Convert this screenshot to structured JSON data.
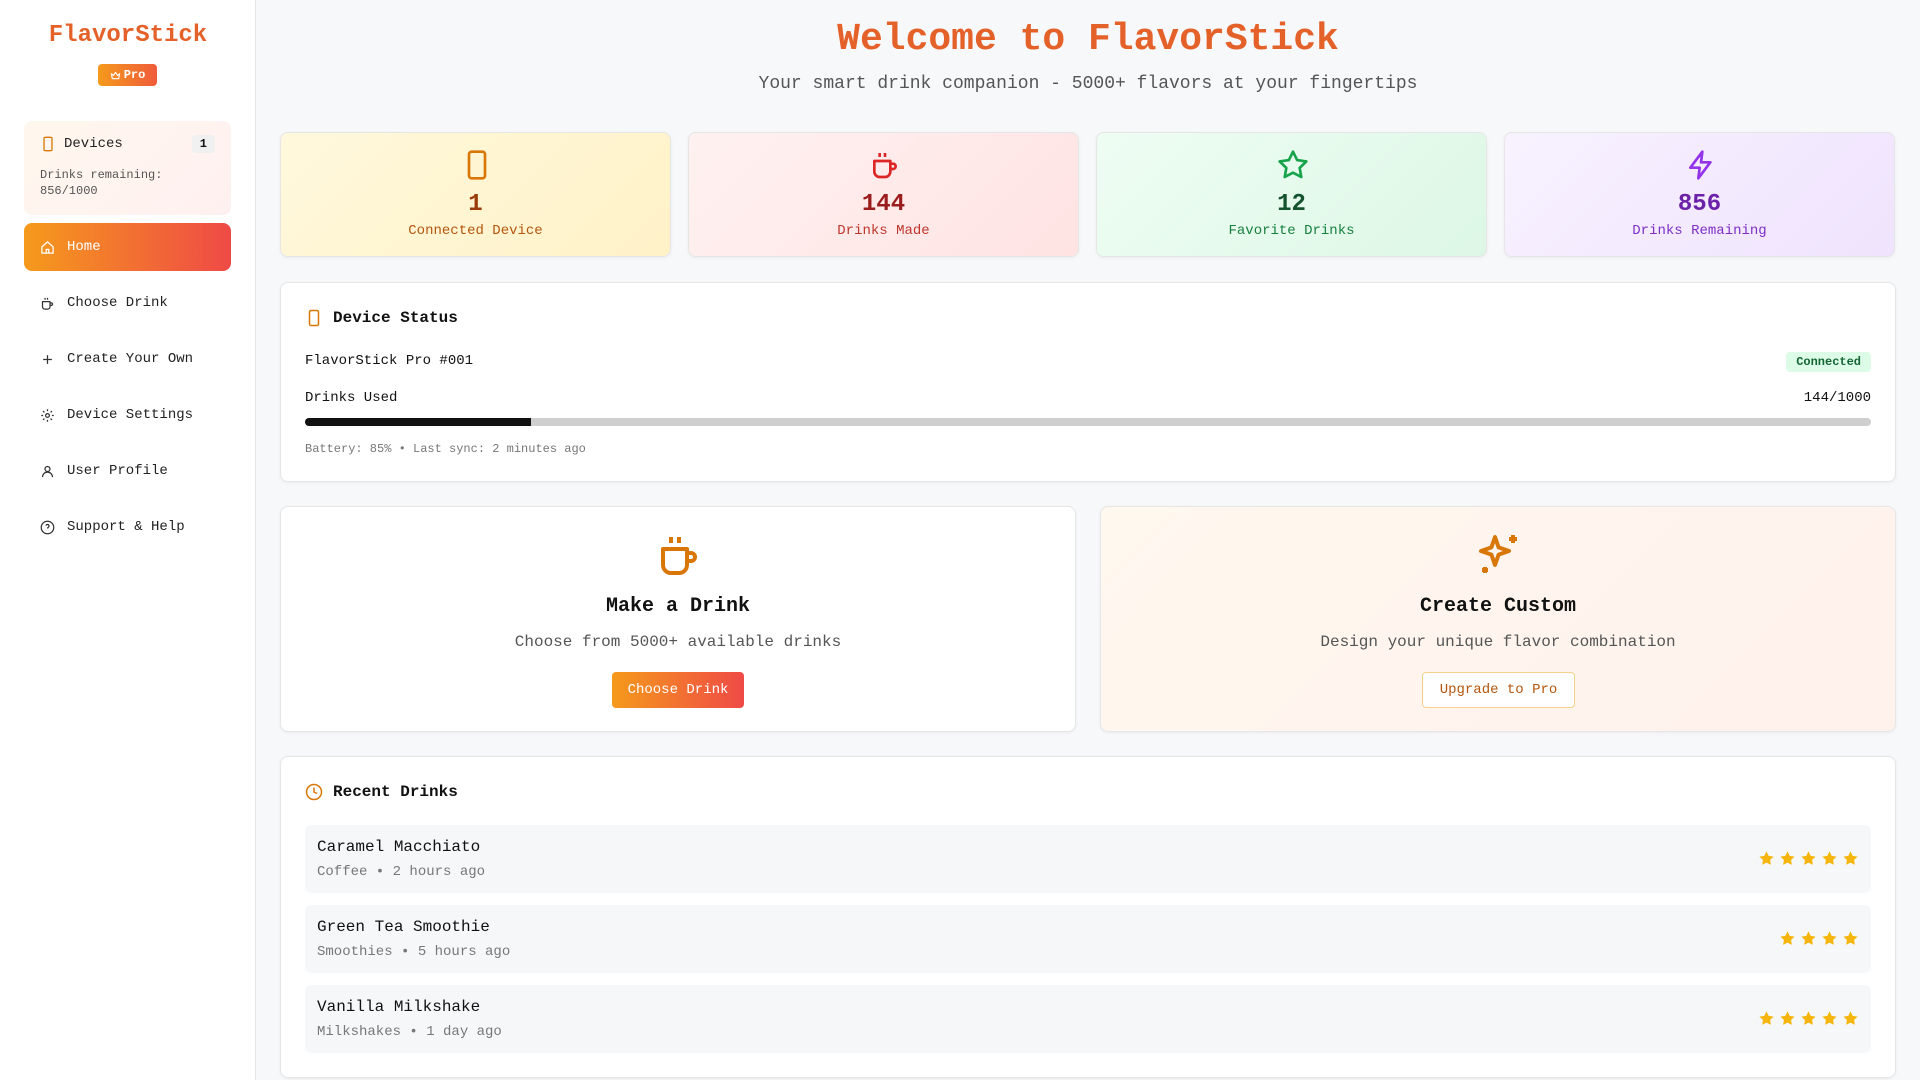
{
  "sidebar": {
    "brand": "FlavorStick",
    "badge": "Pro",
    "devices": {
      "label": "Devices",
      "count": "1",
      "remaining": "Drinks remaining: 856/1000"
    },
    "nav": [
      {
        "label": "Home",
        "icon": "home-icon",
        "active": true
      },
      {
        "label": "Choose Drink",
        "icon": "cup-icon"
      },
      {
        "label": "Create Your Own",
        "icon": "plus-icon"
      },
      {
        "label": "Device Settings",
        "icon": "gear-icon"
      },
      {
        "label": "User Profile",
        "icon": "user-icon"
      },
      {
        "label": "Support & Help",
        "icon": "help-icon"
      }
    ]
  },
  "header": {
    "title": "Welcome to FlavorStick",
    "subtitle": "Your smart drink companion - 5000+ flavors at your fingertips"
  },
  "stats": [
    {
      "value": "1",
      "label": "Connected Device",
      "icon": "device-icon",
      "color": "#d97706"
    },
    {
      "value": "144",
      "label": "Drinks Made",
      "icon": "cup-icon",
      "color": "#dc2626"
    },
    {
      "value": "12",
      "label": "Favorite Drinks",
      "icon": "star-icon",
      "color": "#16a34a"
    },
    {
      "value": "856",
      "label": "Drinks Remaining",
      "icon": "lightning-icon",
      "color": "#9333ea"
    }
  ],
  "device_status": {
    "title": "Device Status",
    "device_name": "FlavorStick Pro #001",
    "status": "Connected",
    "used_label": "Drinks Used",
    "used_value": "144/1000",
    "used_fraction": 0.144,
    "sync": "Battery: 85% • Last sync: 2 minutes ago"
  },
  "actions": {
    "make": {
      "title": "Make a Drink",
      "desc": "Choose from 5000+ available drinks",
      "button": "Choose Drink"
    },
    "custom": {
      "title": "Create Custom",
      "desc": "Design your unique flavor combination",
      "button": "Upgrade to Pro"
    }
  },
  "recent": {
    "title": "Recent Drinks",
    "items": [
      {
        "name": "Caramel Macchiato",
        "meta": "Coffee • 2 hours ago",
        "rating": 5
      },
      {
        "name": "Green Tea Smoothie",
        "meta": "Smoothies • 5 hours ago",
        "rating": 4
      },
      {
        "name": "Vanilla Milkshake",
        "meta": "Milkshakes • 1 day ago",
        "rating": 5
      }
    ]
  },
  "colors": {
    "accent": "#e4622a",
    "gradient_start": "#f59a1c",
    "gradient_end": "#ef4a46",
    "star": "#f5b50a"
  }
}
